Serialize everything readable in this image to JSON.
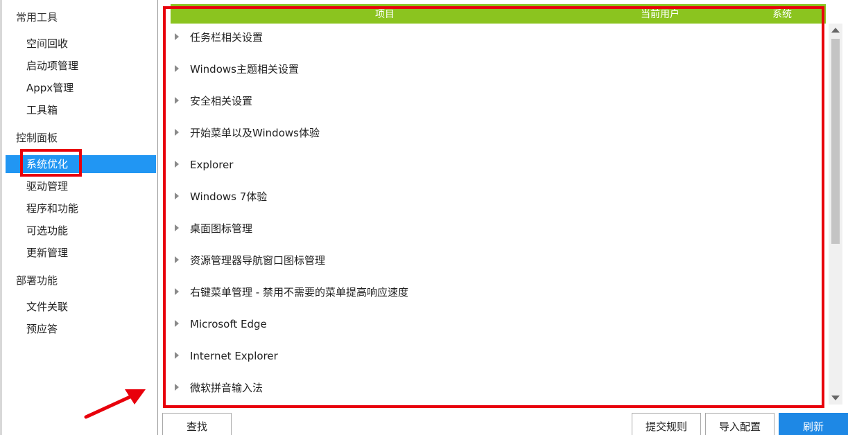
{
  "sidebar": {
    "sections": [
      {
        "title": "常用工具",
        "items": [
          "空间回收",
          "启动项管理",
          "Appx管理",
          "工具箱"
        ]
      },
      {
        "title": "控制面板",
        "items": [
          "系统优化",
          "驱动管理",
          "程序和功能",
          "可选功能",
          "更新管理"
        ]
      },
      {
        "title": "部署功能",
        "items": [
          "文件关联",
          "预应答"
        ]
      }
    ],
    "active_item": "系统优化"
  },
  "list": {
    "headers": {
      "item": "项目",
      "current_user": "当前用户",
      "system": "系统"
    },
    "rows": [
      "任务栏相关设置",
      "Windows主题相关设置",
      "安全相关设置",
      "开始菜单以及Windows体验",
      "Explorer",
      "Windows 7体验",
      "桌面图标管理",
      "资源管理器导航窗口图标管理",
      "右键菜单管理 - 禁用不需要的菜单提高响应速度",
      "Microsoft Edge",
      "Internet Explorer",
      "微软拼音输入法"
    ]
  },
  "buttons": {
    "find": "查找",
    "submit_rules": "提交规则",
    "import_config": "导入配置",
    "refresh": "刷新"
  },
  "colors": {
    "header_bg": "#8bc41f",
    "active_bg": "#2196f3",
    "annotation": "#e8000b",
    "primary_button": "#1e88e5"
  }
}
